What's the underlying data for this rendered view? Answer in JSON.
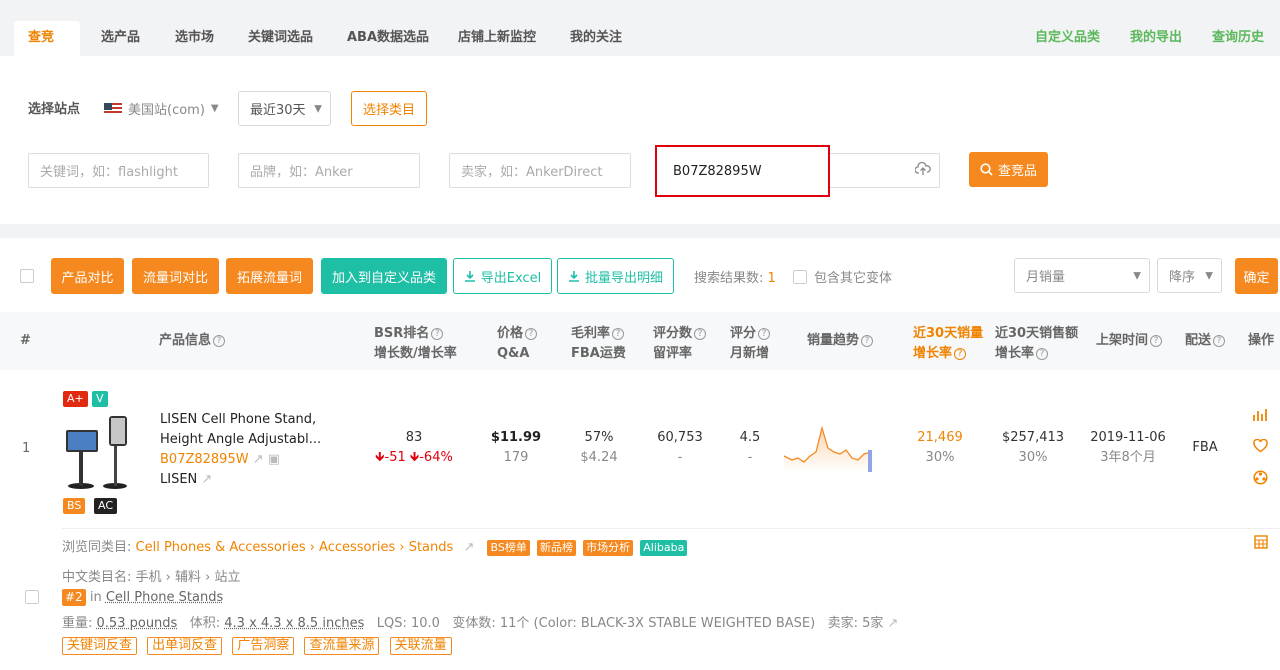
{
  "nav": {
    "tabs": [
      "查竞品",
      "选产品",
      "选市场",
      "关键词选品",
      "ABA数据选品",
      "店铺上新监控",
      "我的关注"
    ],
    "right": [
      "自定义品类",
      "我的导出",
      "查询历史"
    ]
  },
  "filter": {
    "site_label": "选择站点",
    "site_value": "美国站(com)",
    "period": "最近30天",
    "category_button": "选择类目",
    "keyword_placeholder": "关键词，如：flashlight",
    "brand_placeholder": "品牌，如：Anker",
    "seller_placeholder": "卖家，如：AnkerDirect",
    "asin_value": "B07Z82895W",
    "search_button": "查竞品"
  },
  "toolbar": {
    "buttons": [
      "产品对比",
      "流量词对比",
      "拓展流量词",
      "加入到自定义品类"
    ],
    "export_excel": "导出Excel",
    "batch_export": "批量导出明细",
    "result_label": "搜索结果数:",
    "result_count": "1",
    "include_variants": "包含其它变体",
    "sort_field": "月销量",
    "sort_order": "降序",
    "confirm": "确定"
  },
  "columns": {
    "index": "#",
    "product": "产品信息",
    "bsr1": "BSR排名",
    "bsr2": "增长数/增长率",
    "price1": "价格",
    "price2": "Q&A",
    "margin1": "毛利率",
    "margin2": "FBA运费",
    "reviews1": "评分数",
    "reviews2": "留评率",
    "rating1": "评分",
    "rating2": "月新增",
    "trend": "销量趋势",
    "sales1": "近30天销量",
    "sales2": "增长率",
    "revenue1": "近30天销售额",
    "revenue2": "增长率",
    "listed": "上架时间",
    "delivery": "配送",
    "action": "操作"
  },
  "row": {
    "index": "1",
    "badges": {
      "aplus": "A+",
      "v": "V",
      "bs": "BS",
      "ac": "AC"
    },
    "title_line1": "LISEN Cell Phone Stand,",
    "title_line2": "Height Angle Adjustabl...",
    "asin": "B07Z82895W",
    "brand": "LISEN",
    "bsr": "83",
    "bsr_change": "-51",
    "bsr_rate": "-64%",
    "price": "$11.99",
    "qa": "179",
    "margin": "57%",
    "fba": "$4.24",
    "reviews": "60,753",
    "review_rate": "-",
    "rating": "4.5",
    "rating_new": "-",
    "sales": "21,469",
    "sales_growth": "30%",
    "revenue": "$257,413",
    "revenue_growth": "30%",
    "listed_date": "2019-11-06",
    "listed_age": "3年8个月",
    "delivery": "FBA",
    "cat_label": "浏览同类目:",
    "cat_path": "Cell Phones & Accessories › Accessories › Stands",
    "cat_tags": [
      "BS榜单",
      "新品榜",
      "市场分析",
      "Alibaba"
    ],
    "cn_cat": "中文类目名: 手机 › 辅料 › 站立",
    "rank": "#2",
    "rank_in": "in",
    "rank_cat": "Cell Phone Stands",
    "weight_label": "重量:",
    "weight": "0.53 pounds",
    "volume_label": "体积:",
    "volume": "4.3 x 4.3 x 8.5 inches",
    "lqs": "LQS: 10.0",
    "variants": "变体数: 11个 (Color: BLACK-3X STABLE WEIGHTED BASE)",
    "sellers": "卖家: 5家",
    "actions": [
      "关键词反查",
      "出单词反查",
      "广告洞察",
      "查流量来源",
      "关联流量"
    ]
  },
  "colors": {
    "accent": "#f08300",
    "teal": "#1fbfa5",
    "green": "#5cb85c",
    "red": "#e0000e"
  },
  "icons": [
    "chevron-down-icon",
    "search-icon",
    "upload-icon",
    "download-icon",
    "share-icon",
    "comment-icon",
    "bar-chart-icon",
    "heart-icon",
    "target-icon",
    "table-icon",
    "question-icon"
  ]
}
